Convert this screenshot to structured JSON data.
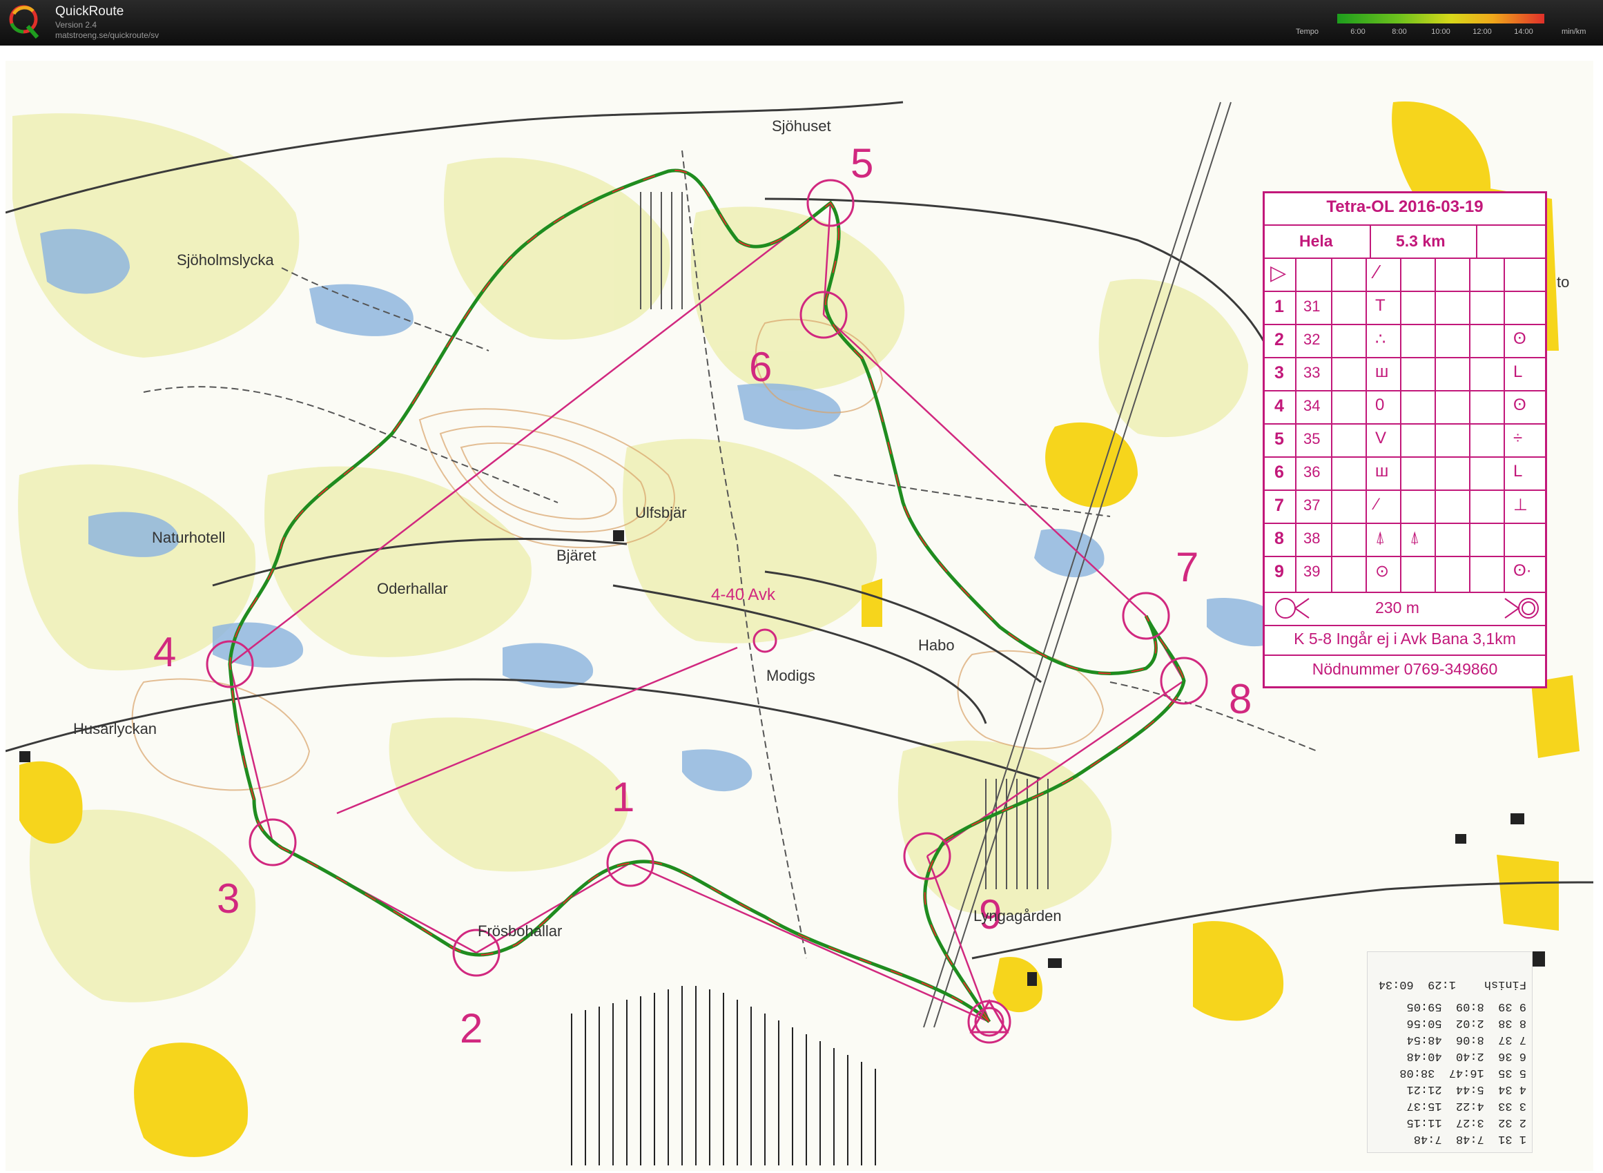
{
  "app": {
    "title": "QuickRoute",
    "version": "Version 2.4",
    "url": "matstroeng.se/quickroute/sv"
  },
  "tempo": {
    "label": "Tempo",
    "unit": "min/km",
    "ticks": [
      "6:00",
      "8:00",
      "10:00",
      "12:00",
      "14:00"
    ]
  },
  "colors": {
    "course": "#d1287f",
    "route_slow": "#1f8c1f",
    "route_fast": "#e0302a",
    "map_forest": "#f4f2c2",
    "map_water": "#7aa8d6",
    "map_open": "#f6d51c"
  },
  "course_card": {
    "title": "Tetra-OL 2016-03-19",
    "class": "Hela",
    "length": "5.3 km",
    "controls": [
      {
        "num": "1",
        "code": "31",
        "sym": "T",
        "sym2": ""
      },
      {
        "num": "2",
        "code": "32",
        "sym": "∴",
        "sym2": "ʘ"
      },
      {
        "num": "3",
        "code": "33",
        "sym": "ш",
        "sym2": "L"
      },
      {
        "num": "4",
        "code": "34",
        "sym": "0",
        "sym2": "ʘ"
      },
      {
        "num": "5",
        "code": "35",
        "sym": "V",
        "sym2": "÷"
      },
      {
        "num": "6",
        "code": "36",
        "sym": "ш",
        "sym2": "L"
      },
      {
        "num": "7",
        "code": "37",
        "sym": "⁄",
        "sym2": "⊥"
      },
      {
        "num": "8",
        "code": "38",
        "sym": "⍋",
        "sym2": "⍋"
      },
      {
        "num": "9",
        "code": "39",
        "sym": "⊙",
        "sym2": "ʘ·"
      }
    ],
    "finish_distance": "230 m",
    "note": "K 5-8 Ingår ej i Avk Bana 3,1km",
    "emergency": "Nödnummer 0769-349860"
  },
  "place_names": [
    "Sjöhuset",
    "Sjöholmslycka",
    "Naturhotell",
    "Oderhallar",
    "Bjäret",
    "Ulfsbjär",
    "Husarlyckan",
    "Frösbohallar",
    "Habo",
    "Modigs",
    "Lyngagården",
    "to"
  ],
  "course_labels": {
    "numbers": [
      "1",
      "2",
      "3",
      "4",
      "5",
      "6",
      "7",
      "8",
      "9"
    ],
    "avk_label": "4-40 Avk"
  },
  "splits": {
    "rows": [
      [
        "1",
        "31",
        "7:48",
        "7:48"
      ],
      [
        "2",
        "32",
        "3:27",
        "11:15"
      ],
      [
        "3",
        "33",
        "4:22",
        "15:37"
      ],
      [
        "4",
        "34",
        "5:44",
        "21:21"
      ],
      [
        "5",
        "35",
        "16:47",
        "38:08"
      ],
      [
        "6",
        "36",
        "2:40",
        "40:48"
      ],
      [
        "7",
        "37",
        "8:06",
        "48:54"
      ],
      [
        "8",
        "38",
        "2:02",
        "50:56"
      ],
      [
        "9",
        "39",
        "8:09",
        "59:05"
      ],
      [
        "Finish",
        "",
        "1:29",
        "60:34"
      ]
    ]
  }
}
